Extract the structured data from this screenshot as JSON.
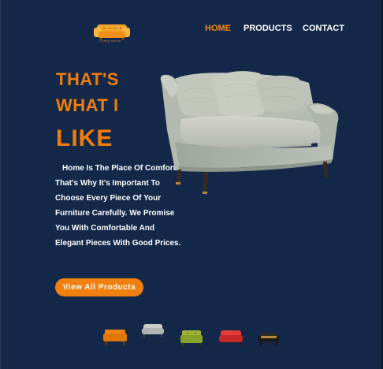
{
  "brand": {
    "logo_text": "Comfy House",
    "accent": "#f07d0c",
    "background": "#142849"
  },
  "nav": {
    "items": [
      {
        "label": "HOME",
        "active": true
      },
      {
        "label": "PRODUCTS",
        "active": false
      },
      {
        "label": "CONTACT",
        "active": false
      }
    ]
  },
  "hero": {
    "headline": [
      "THAT'S",
      "WHAT I",
      "LIKE"
    ],
    "description": "Home Is The Place Of Comfort That's Why It's Important To Choose Every Piece Of Your Furniture Carefully. We Promise You With Comfortable And Elegant Pieces With Good Prices.",
    "cta_label": "View All Products"
  },
  "thumbnails": [
    {
      "icon": "orange-sofa-icon",
      "color": "#f2850f"
    },
    {
      "icon": "grey-sofa-icon",
      "color": "#c9ccc8"
    },
    {
      "icon": "green-sofa-icon",
      "color": "#9db63a"
    },
    {
      "icon": "red-sofa-icon",
      "color": "#e43b3b"
    },
    {
      "icon": "black-sofa-icon",
      "color": "#1c1c1c"
    }
  ]
}
